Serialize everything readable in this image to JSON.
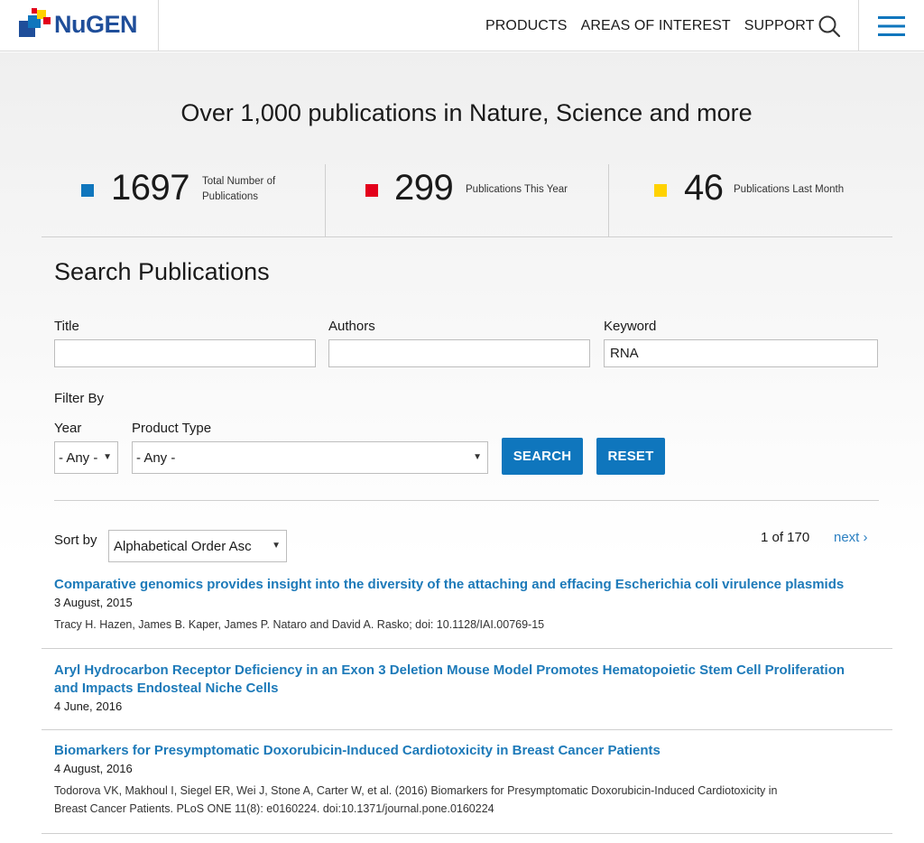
{
  "brand": {
    "name": "NuGEN"
  },
  "nav": {
    "items": [
      "PRODUCTS",
      "AREAS OF INTEREST",
      "SUPPORT"
    ]
  },
  "hero": {
    "headline": "Over 1,000 publications in Nature, Science and more"
  },
  "stats": [
    {
      "value": "1697",
      "label_line1": "Total Number of",
      "label_line2": "Publications",
      "color": "#0f76bd"
    },
    {
      "value": "299",
      "label_line1": "Publications This Year",
      "color": "#e3001b"
    },
    {
      "value": "46",
      "label_line1": "Publications Last Month",
      "color": "#ffd200"
    }
  ],
  "search": {
    "title": "Search Publications",
    "fields": {
      "title_label": "Title",
      "title_value": "",
      "authors_label": "Authors",
      "authors_value": "",
      "keyword_label": "Keyword",
      "keyword_value": "RNA"
    },
    "filter_by": "Filter By",
    "year_label": "Year",
    "year_value": "- Any -",
    "product_type_label": "Product Type",
    "product_type_value": "- Any -",
    "search_button": "SEARCH",
    "reset_button": "RESET"
  },
  "results": {
    "sort_label": "Sort by",
    "sort_value": "Alphabetical Order Asc",
    "pager_count": "1 of 170",
    "pager_next": "next ›",
    "items": [
      {
        "title": "Comparative genomics provides insight into the diversity of the attaching and effacing Escherichia coli virulence plasmids",
        "date": "3 August, 2015",
        "desc": "Tracy H. Hazen, James B. Kaper, James P. Nataro and David A. Rasko; doi: 10.1128/IAI.00769-15"
      },
      {
        "title_line1": "Aryl Hydrocarbon Receptor Deficiency in an Exon 3 Deletion Mouse Model Promotes Hematopoietic Stem Cell Proliferation",
        "title_line2": "and Impacts Endosteal Niche Cells",
        "date": "4 June, 2016"
      },
      {
        "title": "Biomarkers for Presymptomatic Doxorubicin-Induced Cardiotoxicity in Breast Cancer Patients",
        "date": "4 August, 2016",
        "desc_line1": "Todorova VK, Makhoul I, Siegel ER, Wei J, Stone A, Carter W, et al. (2016) Biomarkers for Presymptomatic Doxorubicin-Induced Cardiotoxicity in",
        "desc_line2": "Breast Cancer Patients. PLoS ONE 11(8): e0160224. doi:10.1371/journal.pone.0160224"
      }
    ]
  },
  "icons": {
    "search": "search-icon",
    "menu": "menu-icon",
    "dropdown": "chevron-down-icon"
  }
}
